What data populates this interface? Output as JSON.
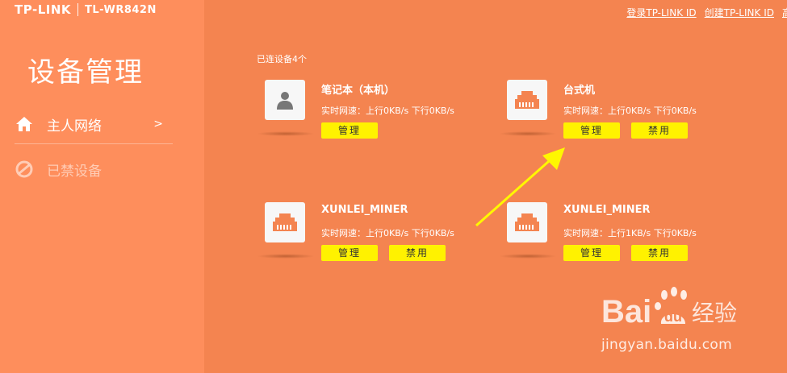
{
  "header": {
    "brand": "TP-LINK",
    "model": "TL-WR842N",
    "links": [
      "登录TP-LINK ID",
      "创建TP-LINK ID",
      "高"
    ]
  },
  "sidebar": {
    "title": "设备管理",
    "items": [
      {
        "label": "主人网络",
        "icon": "home-icon",
        "chevron": ">"
      },
      {
        "label": "已禁设备",
        "icon": "ban-icon"
      }
    ]
  },
  "main": {
    "connected_label": "已连设备4个",
    "devices": [
      {
        "name": "笔记本（本机）",
        "speed": "实时网速：上行0KB/s  下行0KB/s",
        "icon": "person-icon",
        "buttons": [
          "管理"
        ]
      },
      {
        "name": "台式机",
        "speed": "实时网速：上行0KB/s  下行0KB/s",
        "icon": "ethernet-icon",
        "buttons": [
          "管理",
          "禁用"
        ]
      },
      {
        "name": "XUNLEI_MINER",
        "speed": "实时网速：上行0KB/s  下行0KB/s",
        "icon": "ethernet-icon",
        "buttons": [
          "管理",
          "禁用"
        ]
      },
      {
        "name": "XUNLEI_MINER",
        "speed": "实时网速：上行1KB/s  下行0KB/s",
        "icon": "ethernet-icon",
        "buttons": [
          "管理",
          "禁用"
        ]
      }
    ]
  },
  "watermark": {
    "url": "jingyan.baidu.com"
  },
  "colors": {
    "background": "#f48450",
    "sidebar": "#fe8e5c",
    "button": "#fff200",
    "arrow": "#fff700"
  }
}
